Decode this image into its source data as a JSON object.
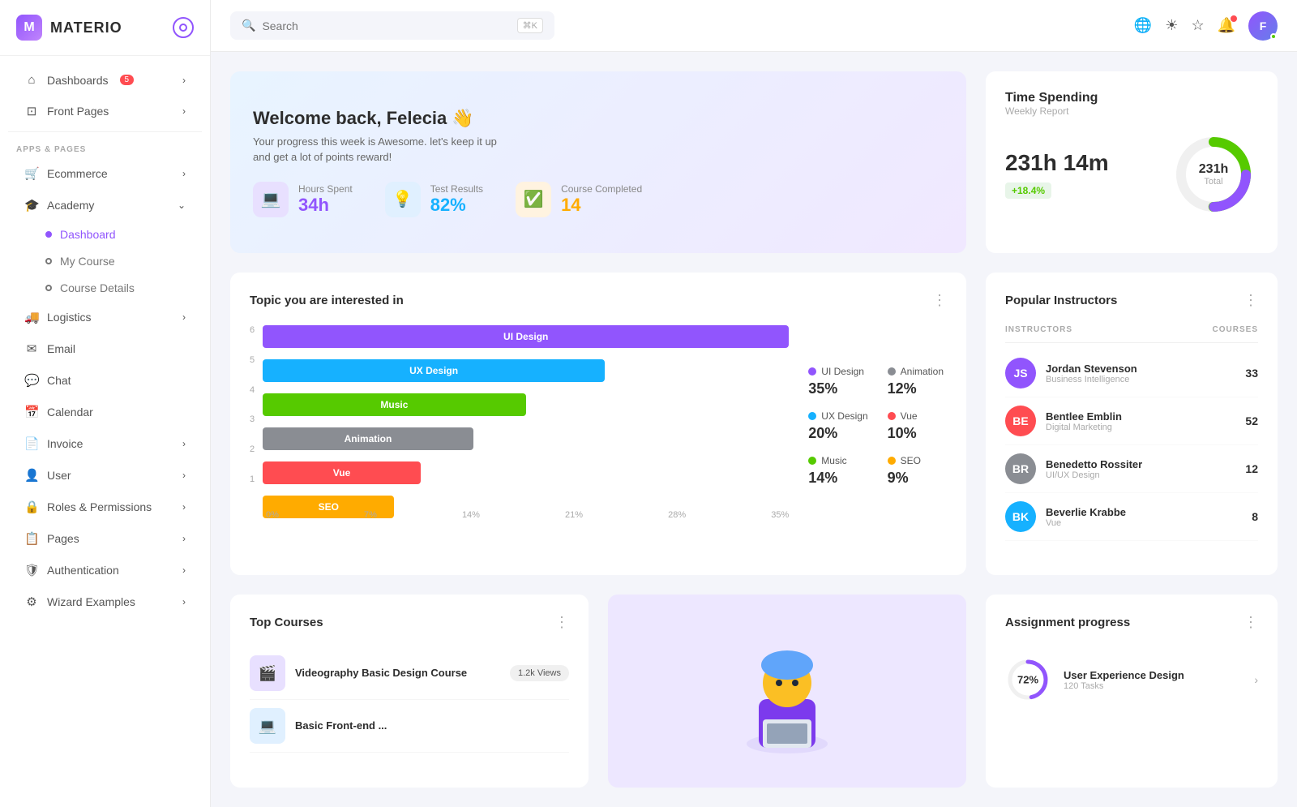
{
  "app": {
    "logo_letter": "M",
    "logo_name": "MATERIO"
  },
  "topbar": {
    "search_placeholder": "Search",
    "search_kbd": "⌘K",
    "translate_icon": "🌐",
    "theme_icon": "☀",
    "star_icon": "☆",
    "notification_icon": "🔔",
    "avatar_initials": "F"
  },
  "sidebar": {
    "nav_items": [
      {
        "id": "dashboards",
        "label": "Dashboards",
        "icon": "⌂",
        "badge": "5",
        "has_children": true
      },
      {
        "id": "front-pages",
        "label": "Front Pages",
        "icon": "□",
        "has_children": true
      }
    ],
    "section_label": "APPS & PAGES",
    "apps_items": [
      {
        "id": "ecommerce",
        "label": "Ecommerce",
        "icon": "🛒",
        "has_children": true
      },
      {
        "id": "academy",
        "label": "Academy",
        "icon": "🎓",
        "has_children": true,
        "expanded": true
      }
    ],
    "academy_sub": [
      {
        "id": "dashboard",
        "label": "Dashboard",
        "active": true
      },
      {
        "id": "my-course",
        "label": "My Course",
        "active": false
      },
      {
        "id": "course-details",
        "label": "Course Details",
        "active": false
      }
    ],
    "more_items": [
      {
        "id": "logistics",
        "label": "Logistics",
        "icon": "🚚",
        "has_children": true
      },
      {
        "id": "email",
        "label": "Email",
        "icon": "✉"
      },
      {
        "id": "chat",
        "label": "Chat",
        "icon": "💬"
      },
      {
        "id": "calendar",
        "label": "Calendar",
        "icon": "📅"
      },
      {
        "id": "invoice",
        "label": "Invoice",
        "icon": "📄",
        "has_children": true
      },
      {
        "id": "user",
        "label": "User",
        "icon": "👤",
        "has_children": true
      },
      {
        "id": "roles",
        "label": "Roles & Permissions",
        "icon": "🔒",
        "has_children": true
      },
      {
        "id": "pages",
        "label": "Pages",
        "icon": "📋",
        "has_children": true
      },
      {
        "id": "authentication",
        "label": "Authentication",
        "icon": "🛡",
        "has_children": true
      },
      {
        "id": "wizard",
        "label": "Wizard Examples",
        "icon": "⚙",
        "has_children": true
      }
    ]
  },
  "welcome": {
    "title": "Welcome back, Felecia 👋",
    "subtitle": "Your progress this week is Awesome. let's keep it up",
    "subtitle2": "and get a lot of points reward!",
    "stats": [
      {
        "id": "hours",
        "label": "Hours Spent",
        "value": "34h",
        "color": "purple",
        "icon": "💻"
      },
      {
        "id": "test",
        "label": "Test Results",
        "value": "82%",
        "color": "blue",
        "icon": "💡"
      },
      {
        "id": "course",
        "label": "Course Completed",
        "value": "14",
        "color": "orange",
        "icon": "✅"
      }
    ]
  },
  "time_spending": {
    "title": "Time Spending",
    "subtitle": "Weekly Report",
    "value": "231h 14m",
    "donut_value": "231h",
    "donut_sub": "Total",
    "badge": "+18.4%",
    "donut_pct": 75
  },
  "topics": {
    "title": "Topic you are interested in",
    "bars": [
      {
        "label": "6",
        "name": "UI Design",
        "pct": 100,
        "color": "#9155fd",
        "bar_label": "UI Design"
      },
      {
        "label": "5",
        "name": "UX Design",
        "pct": 65,
        "color": "#16b1ff",
        "bar_label": "UX Design"
      },
      {
        "label": "4",
        "name": "Music",
        "pct": 50,
        "color": "#56ca00",
        "bar_label": "Music"
      },
      {
        "label": "3",
        "name": "Animation",
        "pct": 40,
        "color": "#8a8d93",
        "bar_label": "Animation"
      },
      {
        "label": "2",
        "name": "Vue",
        "pct": 30,
        "color": "#ff4c51",
        "bar_label": "Vue"
      },
      {
        "label": "1",
        "name": "SEO",
        "pct": 25,
        "color": "#ffab00",
        "bar_label": "SEO"
      }
    ],
    "x_labels": [
      "0%",
      "7%",
      "14%",
      "21%",
      "28%",
      "35%"
    ],
    "legend": [
      {
        "name": "UI Design",
        "pct": "35%",
        "color": "#9155fd"
      },
      {
        "name": "Animation",
        "pct": "12%",
        "color": "#8a8d93"
      },
      {
        "name": "UX Design",
        "pct": "20%",
        "color": "#16b1ff"
      },
      {
        "name": "Vue",
        "pct": "10%",
        "color": "#ff4c51"
      },
      {
        "name": "Music",
        "pct": "14%",
        "color": "#56ca00"
      },
      {
        "name": "SEO",
        "pct": "9%",
        "color": "#ffab00"
      }
    ]
  },
  "instructors": {
    "title": "Popular Instructors",
    "col_instructors": "INSTRUCTORS",
    "col_courses": "COURSES",
    "list": [
      {
        "name": "Jordan Stevenson",
        "role": "Business Intelligence",
        "courses": 33,
        "color": "#9155fd",
        "initials": "JS"
      },
      {
        "name": "Bentlee Emblin",
        "role": "Digital Marketing",
        "courses": 52,
        "color": "#ff4c51",
        "initials": "BE"
      },
      {
        "name": "Benedetto Rossiter",
        "role": "UI/UX Design",
        "courses": 12,
        "color": "#8a8d93",
        "initials": "BR"
      },
      {
        "name": "Beverlie Krabbe",
        "role": "Vue",
        "courses": 8,
        "color": "#16b1ff",
        "initials": "BK"
      }
    ]
  },
  "top_courses": {
    "title": "Top Courses",
    "courses": [
      {
        "name": "Videography Basic Design Course",
        "views": "1.2k Views",
        "icon": "🎬",
        "thumb_color": "#e8e0ff"
      },
      {
        "name": "Basic Front-end ...",
        "views": "",
        "icon": "💻",
        "thumb_color": "#e0f0ff"
      }
    ]
  },
  "assignment": {
    "title": "Assignment progress",
    "items": [
      {
        "name": "User Experience Design",
        "tasks": "120 Tasks",
        "pct": 72,
        "color": "#9155fd"
      }
    ]
  }
}
